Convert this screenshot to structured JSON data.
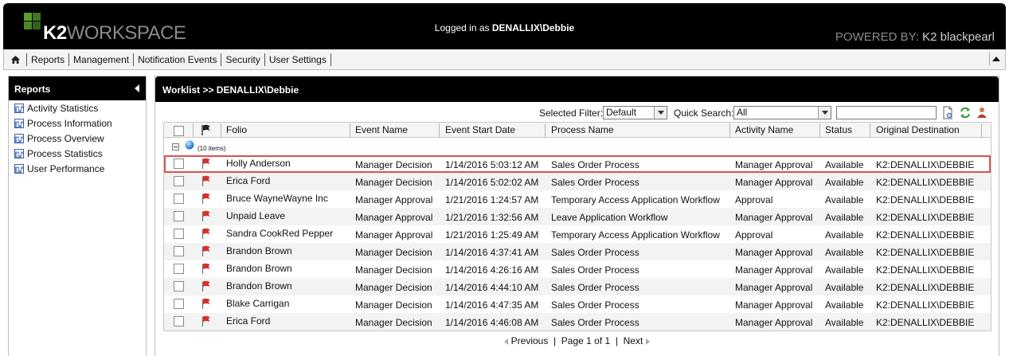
{
  "header": {
    "logo_k2": "K2",
    "logo_workspace": "WORKSPACE",
    "login_prefix": "Logged in as ",
    "login_user": "DENALLIX\\Debbie",
    "powered_prefix": "POWERED BY: ",
    "powered_product": "K2 blackpearl"
  },
  "menu": {
    "items": [
      "Reports",
      "Management",
      "Notification Events",
      "Security",
      "User Settings"
    ]
  },
  "reports": {
    "title": "Reports",
    "items": [
      "Activity Statistics",
      "Process Information",
      "Process Overview",
      "Process Statistics",
      "User Performance"
    ]
  },
  "worklist": {
    "title": "Worklist >> DENALLIX\\Debbie",
    "filter_label": "Selected Filter:",
    "filter_value": "Default",
    "quick_search_label": "Quick Search:",
    "quick_search_value": "All",
    "search_text": "",
    "columns": [
      "Folio",
      "Event Name",
      "Event Start Date",
      "Process Name",
      "Activity Name",
      "Status",
      "Original Destination"
    ],
    "group_count": "(10 items)",
    "rows": [
      {
        "folio": "Holly Anderson",
        "event": "Manager Decision",
        "date": "1/14/2016 5:03:12 AM",
        "process": "Sales Order Process",
        "activity": "Manager Approval",
        "status": "Available",
        "dest": "K2:DENALLIX\\DEBBIE",
        "selected": true
      },
      {
        "folio": "Erica Ford",
        "event": "Manager Decision",
        "date": "1/14/2016 5:02:02 AM",
        "process": "Sales Order Process",
        "activity": "Manager Approval",
        "status": "Available",
        "dest": "K2:DENALLIX\\DEBBIE"
      },
      {
        "folio": "Bruce WayneWayne Inc",
        "event": "Manager Approval",
        "date": "1/21/2016 1:24:57 AM",
        "process": "Temporary Access Application Workflow",
        "activity": "Approval",
        "status": "Available",
        "dest": "K2:DENALLIX\\DEBBIE"
      },
      {
        "folio": "Unpaid Leave",
        "event": "Manager Approval",
        "date": "1/21/2016 1:32:56 AM",
        "process": "Leave Application Workflow",
        "activity": "Manager Approval",
        "status": "Available",
        "dest": "K2:DENALLIX\\DEBBIE"
      },
      {
        "folio": "Sandra CookRed Pepper",
        "event": "Manager Approval",
        "date": "1/21/2016 1:25:49 AM",
        "process": "Temporary Access Application Workflow",
        "activity": "Approval",
        "status": "Available",
        "dest": "K2:DENALLIX\\DEBBIE"
      },
      {
        "folio": "Brandon Brown",
        "event": "Manager Decision",
        "date": "1/14/2016 4:37:41 AM",
        "process": "Sales Order Process",
        "activity": "Manager Approval",
        "status": "Available",
        "dest": "K2:DENALLIX\\DEBBIE"
      },
      {
        "folio": "Brandon Brown",
        "event": "Manager Decision",
        "date": "1/14/2016 4:26:16 AM",
        "process": "Sales Order Process",
        "activity": "Manager Approval",
        "status": "Available",
        "dest": "K2:DENALLIX\\DEBBIE"
      },
      {
        "folio": "Brandon Brown",
        "event": "Manager Decision",
        "date": "1/14/2016 4:44:10 AM",
        "process": "Sales Order Process",
        "activity": "Manager Approval",
        "status": "Available",
        "dest": "K2:DENALLIX\\DEBBIE"
      },
      {
        "folio": "Blake Carrigan",
        "event": "Manager Decision",
        "date": "1/14/2016 4:47:35 AM",
        "process": "Sales Order Process",
        "activity": "Manager Approval",
        "status": "Available",
        "dest": "K2:DENALLIX\\DEBBIE"
      },
      {
        "folio": "Erica Ford",
        "event": "Manager Decision",
        "date": "1/14/2016 4:46:08 AM",
        "process": "Sales Order Process",
        "activity": "Manager Approval",
        "status": "Available",
        "dest": "K2:DENALLIX\\DEBBIE"
      }
    ],
    "pager": {
      "previous": "Previous",
      "page_info": "Page 1 of 1",
      "next": "Next"
    }
  },
  "colors": {
    "brand_green": "#5a9e2f",
    "header_bg": "#000000",
    "selected_outline": "#d9534f",
    "flag_red": "#d9302c"
  },
  "icons": [
    "home-icon",
    "collapse-up-icon",
    "report-icon",
    "panel-collapse-icon",
    "flag-icon",
    "globe-icon",
    "expand-minus-icon",
    "export-icon",
    "refresh-icon",
    "user-icon"
  ]
}
